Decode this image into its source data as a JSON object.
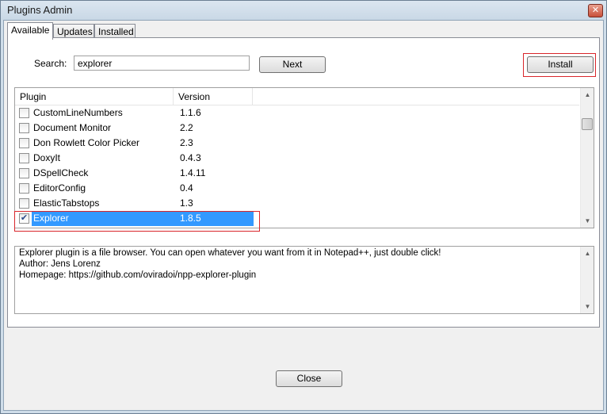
{
  "window": {
    "title": "Plugins Admin"
  },
  "tabs": [
    {
      "label": "Available",
      "active": true
    },
    {
      "label": "Updates",
      "active": false
    },
    {
      "label": "Installed",
      "active": false
    }
  ],
  "search": {
    "label": "Search:",
    "value": "explorer"
  },
  "buttons": {
    "next": "Next",
    "install": "Install",
    "close": "Close"
  },
  "list": {
    "columns": [
      "Plugin",
      "Version"
    ],
    "rows": [
      {
        "name": "CustomLineNumbers",
        "version": "1.1.6",
        "checked": false,
        "selected": false
      },
      {
        "name": "Document Monitor",
        "version": "2.2",
        "checked": false,
        "selected": false
      },
      {
        "name": "Don Rowlett Color Picker",
        "version": "2.3",
        "checked": false,
        "selected": false
      },
      {
        "name": "DoxyIt",
        "version": "0.4.3",
        "checked": false,
        "selected": false
      },
      {
        "name": "DSpellCheck",
        "version": "1.4.11",
        "checked": false,
        "selected": false
      },
      {
        "name": "EditorConfig",
        "version": "0.4",
        "checked": false,
        "selected": false
      },
      {
        "name": "ElasticTabstops",
        "version": "1.3",
        "checked": false,
        "selected": false
      },
      {
        "name": "Explorer",
        "version": "1.8.5",
        "checked": true,
        "selected": true
      }
    ]
  },
  "description": {
    "lines": [
      "Explorer plugin is a file browser. You can open whatever you want from it in Notepad++, just double click!",
      "Author: Jens Lorenz",
      "Homepage: https://github.com/oviradoi/npp-explorer-plugin"
    ]
  },
  "icons": {
    "close": "close-icon",
    "check": "checkmark-icon"
  },
  "colors": {
    "selection": "#3399ff",
    "highlight_box": "#d9262b"
  }
}
